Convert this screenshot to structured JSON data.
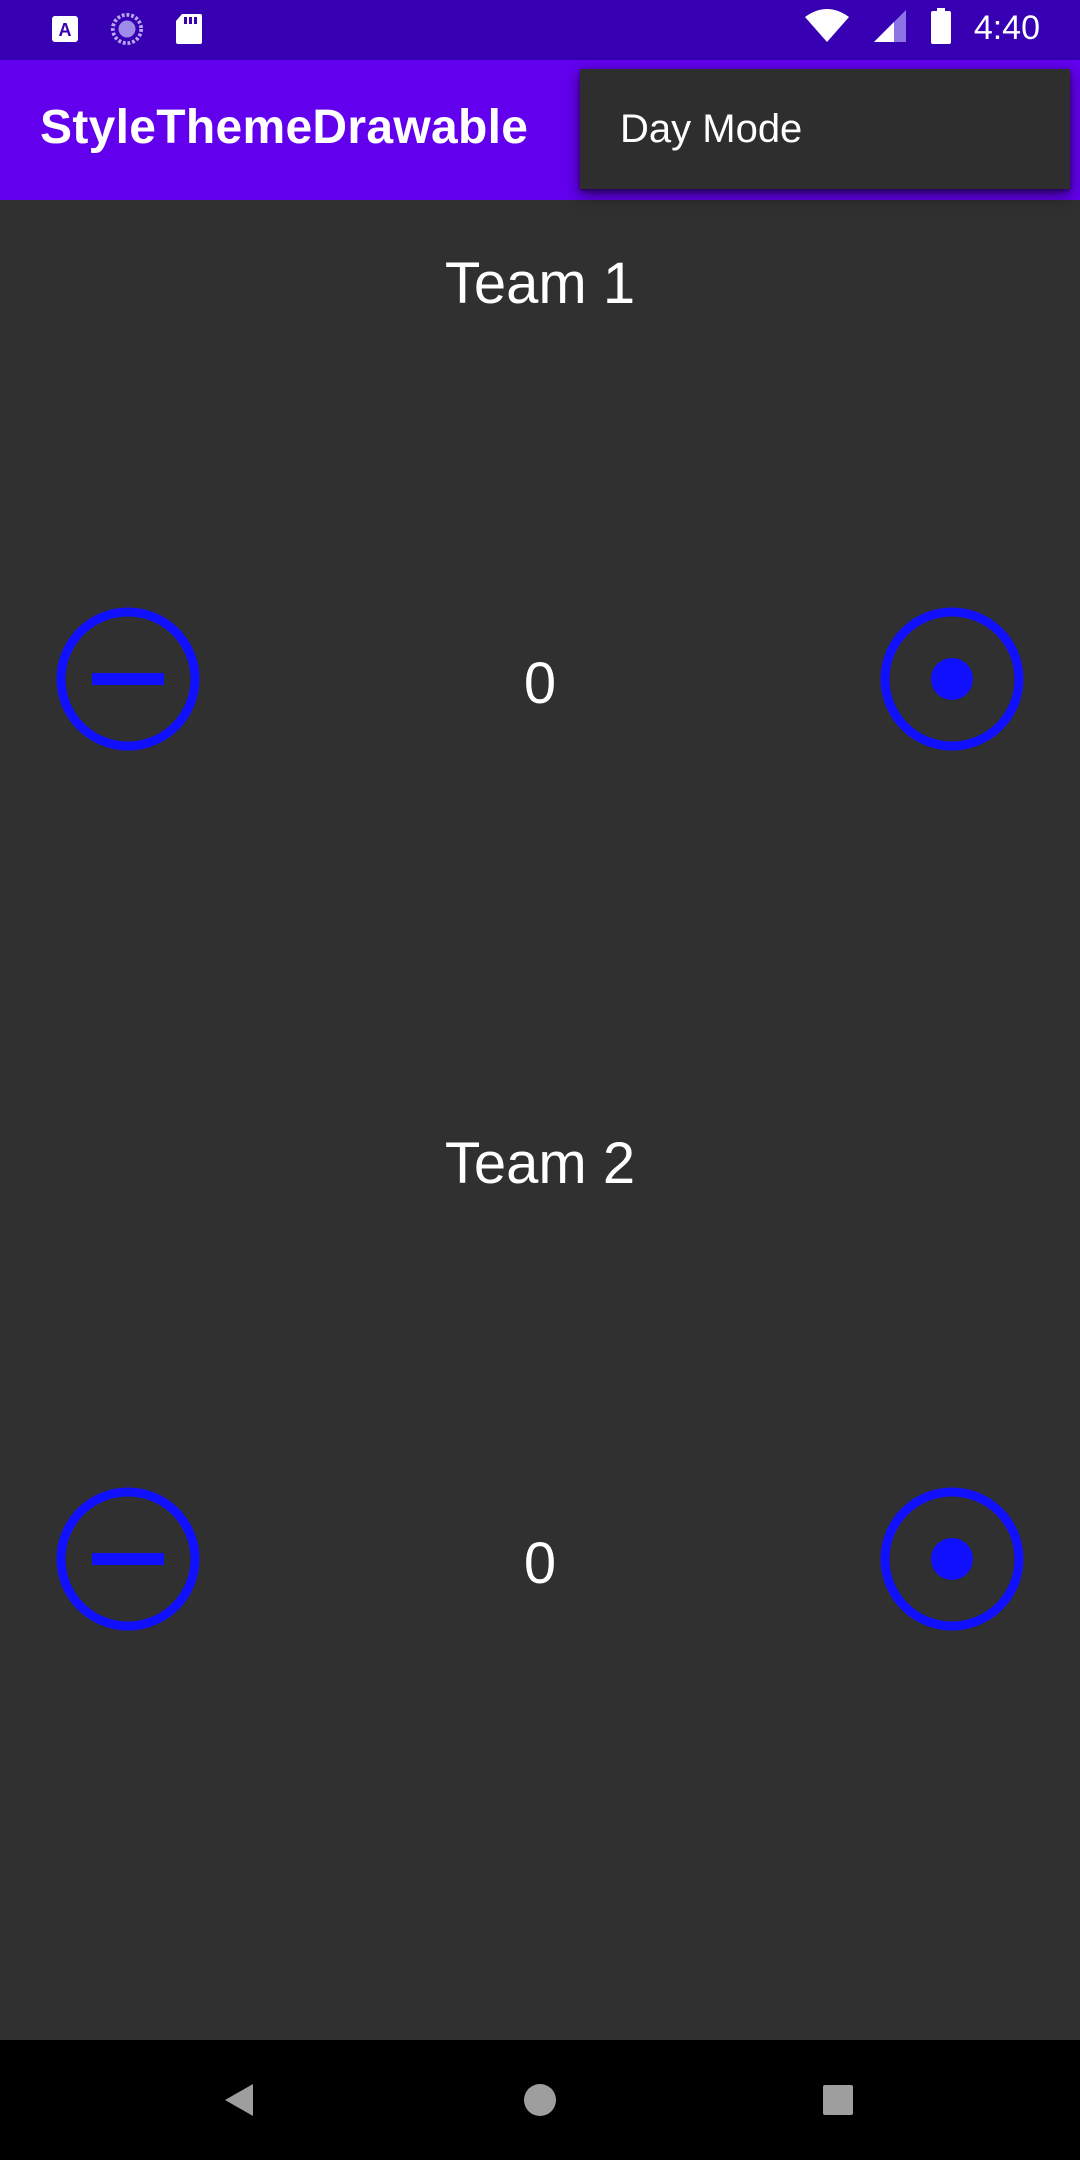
{
  "status_bar": {
    "time": "4:40",
    "left_icons": [
      "font-a-icon",
      "sync-circle-icon",
      "sd-card-icon"
    ],
    "right_icons": [
      "wifi-icon",
      "cell-signal-icon",
      "battery-icon"
    ]
  },
  "app_bar": {
    "title": "StyleThemeDrawable"
  },
  "menu": {
    "items": [
      {
        "label": "Day Mode"
      }
    ]
  },
  "teams": [
    {
      "name": "Team 1",
      "score": "0"
    },
    {
      "name": "Team 2",
      "score": "0"
    }
  ],
  "colors": {
    "status_bar": "#3700B3",
    "app_bar": "#6200EE",
    "background": "#303030",
    "button_accent": "#1010FF"
  },
  "nav_bar": {
    "buttons": [
      "back-icon",
      "home-icon",
      "recents-icon"
    ]
  }
}
